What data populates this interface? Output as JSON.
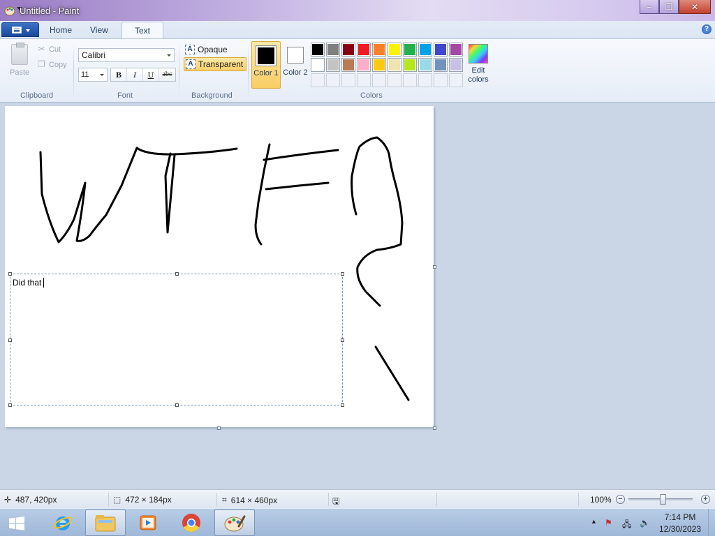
{
  "window": {
    "title": "Untitled - Paint",
    "min_glyph": "–",
    "max_glyph": "❐",
    "close_glyph": "✕"
  },
  "tabs": {
    "home": "Home",
    "view": "View",
    "text": "Text",
    "help_glyph": "?"
  },
  "clipboard": {
    "paste": "Paste",
    "cut": "Cut",
    "copy": "Copy",
    "group_label": "Clipboard"
  },
  "font": {
    "family": "Calibri",
    "size": "11",
    "bold": "B",
    "italic": "I",
    "underline": "U",
    "strikethrough": "abc",
    "group_label": "Font"
  },
  "background": {
    "opaque": "Opaque",
    "transparent": "Transparent",
    "selected": "transparent",
    "group_label": "Background"
  },
  "colors": {
    "color1_label": "Color 1",
    "color2_label": "Color 2",
    "color1_value": "#000000",
    "color2_value": "#ffffff",
    "edit_label": "Edit colors",
    "group_label": "Colors",
    "palette": [
      "#000000",
      "#7f7f7f",
      "#880015",
      "#ed1c24",
      "#ff7f27",
      "#fff200",
      "#22b14c",
      "#00a2e8",
      "#3f48cc",
      "#a349a4",
      "#ffffff",
      "#c3c3c3",
      "#b97a57",
      "#ffaec9",
      "#ffc90e",
      "#efe4b0",
      "#b5e61d",
      "#99d9ea",
      "#7092be",
      "#c8bfe7"
    ],
    "custom_slots": 10
  },
  "canvas": {
    "typed_text": "Did that"
  },
  "status": {
    "cursor_pos": "487, 420px",
    "selection_size": "472 × 184px",
    "image_size": "614 × 460px",
    "zoom": "100%",
    "zoom_out": "−",
    "zoom_in": "+"
  },
  "taskbar": {
    "time": "7:14 PM",
    "date": "12/30/2023",
    "tray_up": "▲"
  }
}
